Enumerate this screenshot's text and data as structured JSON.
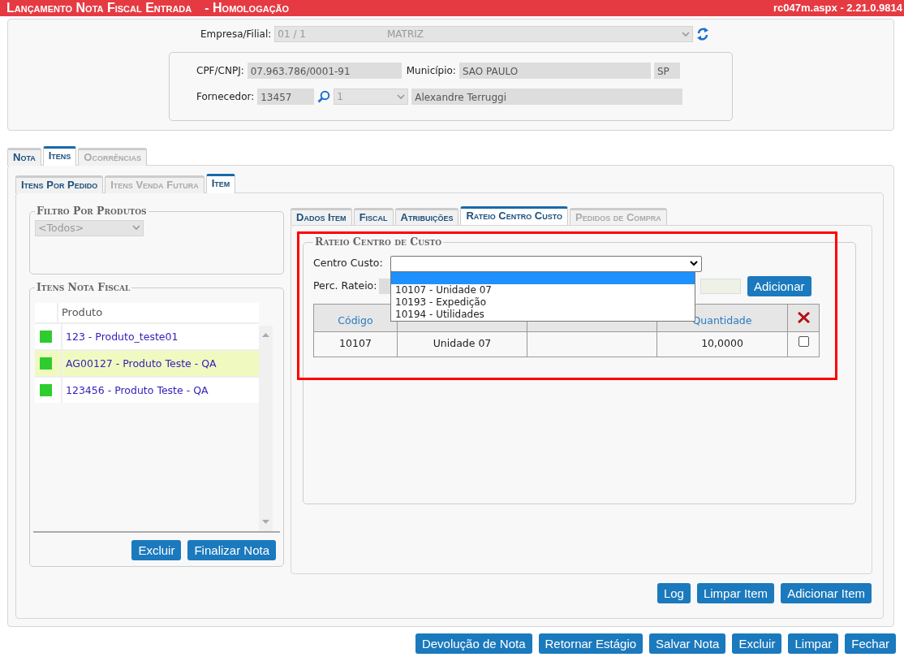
{
  "title": {
    "text": "Lançamento Nota Fiscal Entrada",
    "environment": "- Homologação",
    "version": "rc047m.aspx - 2.21.0.9814"
  },
  "header": {
    "empresa": {
      "label": "Empresa/Filial:",
      "code": "01 / 1",
      "name": "MATRIZ",
      "disabled": true
    },
    "cnpj": {
      "label": "CPF/CNPJ:",
      "value": "07.963.786/0001-91"
    },
    "municipio": {
      "label": "Município:",
      "value": "SAO PAULO",
      "uf": "SP"
    },
    "fornecedor": {
      "label": "Fornecedor:",
      "code": "13457",
      "branch": "1",
      "name": "Alexandre Terruggi"
    }
  },
  "main_tabs": [
    {
      "label": "Nota",
      "selected": false,
      "disabled": false
    },
    {
      "label": "Itens",
      "selected": true,
      "disabled": false
    },
    {
      "label": "Ocorrências",
      "selected": false,
      "disabled": true
    }
  ],
  "sub_tabs": [
    {
      "label": "Itens Por Pedido",
      "selected": false,
      "disabled": false
    },
    {
      "label": "Itens Venda Futura",
      "selected": false,
      "disabled": true
    },
    {
      "label": "Item",
      "selected": true,
      "disabled": false
    }
  ],
  "filter": {
    "legend": "Filtro Por Produtos",
    "value": "<Todos>",
    "disabled": true
  },
  "items": {
    "legend": "Itens Nota Fiscal",
    "column": "Produto",
    "rows": [
      {
        "label": "123 - Produto_teste01",
        "selected": false
      },
      {
        "label": "AG00127 - Produto Teste - QA",
        "selected": true
      },
      {
        "label": "123456 - Produto Teste - QA",
        "selected": false
      }
    ],
    "buttons": [
      "Excluir",
      "Finalizar Nota"
    ]
  },
  "detail_tabs": [
    {
      "label": "Dados Item",
      "selected": false,
      "disabled": false
    },
    {
      "label": "Fiscal",
      "selected": false,
      "disabled": false
    },
    {
      "label": "Atribuições",
      "selected": false,
      "disabled": false
    },
    {
      "label": "Rateio Centro Custo",
      "selected": true,
      "disabled": false
    },
    {
      "label": "Pedidos de Compra",
      "selected": false,
      "disabled": true
    }
  ],
  "rateio": {
    "legend": "Rateio Centro de Custo",
    "centro_label": "Centro Custo:",
    "dropdown_open": true,
    "blank_option_highlighted": true,
    "options": [
      {
        "label": "10107 - Unidade 07",
        "selected": false
      },
      {
        "label": "10193 - Expedição",
        "selected": false
      },
      {
        "label": "10194 - Utilidades",
        "selected": false
      }
    ],
    "perc_label": "Perc. Rateio:",
    "add_button": "Adicionar",
    "columns": [
      "Código",
      null,
      null,
      "Quantidade"
    ],
    "rows": [
      {
        "codigo": "10107",
        "descricao": "Unidade 07",
        "quantidade": "10,0000",
        "checked": false
      }
    ]
  },
  "item_buttons": [
    "Log",
    "Limpar Item",
    "Adicionar Item"
  ],
  "footer_buttons": [
    "Devolução de Nota",
    "Retornar Estágio",
    "Salvar Nota",
    "Excluir",
    "Limpar",
    "Fechar"
  ]
}
